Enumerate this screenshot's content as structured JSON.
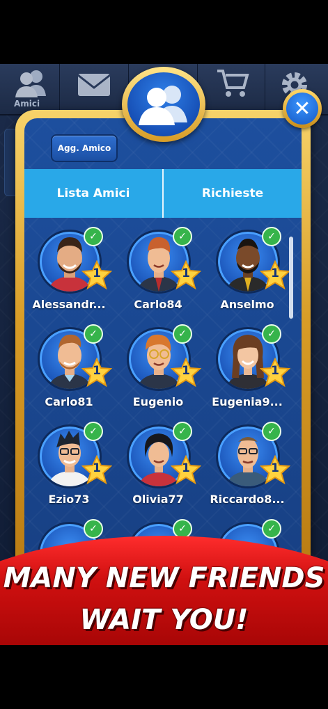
{
  "topbar": {
    "tab_label": "Amici"
  },
  "panel": {
    "add_friend_label": "Agg. Amico",
    "tabs": [
      {
        "label": "Lista Amici",
        "active": true
      },
      {
        "label": "Richieste",
        "active": false
      }
    ],
    "close_label": "✕"
  },
  "friends": [
    {
      "name": "Alessandr...",
      "level": "1",
      "online": true
    },
    {
      "name": "Carlo84",
      "level": "1",
      "online": true
    },
    {
      "name": "Anselmo",
      "level": "1",
      "online": true
    },
    {
      "name": "Carlo81",
      "level": "1",
      "online": true
    },
    {
      "name": "Eugenio",
      "level": "1",
      "online": true
    },
    {
      "name": "Eugenia9...",
      "level": "1",
      "online": true
    },
    {
      "name": "Ezio73",
      "level": "1",
      "online": true
    },
    {
      "name": "Olivia77",
      "level": "1",
      "online": true
    },
    {
      "name": "Riccardo8...",
      "level": "1",
      "online": true
    }
  ],
  "banner": {
    "line1": "MANY NEW FRIENDS",
    "line2": "WAIT YOU!"
  },
  "colors": {
    "panel_gold": "#d89c26",
    "panel_blue": "#1d4f9e",
    "tab_blue": "#29a8e8",
    "online_green": "#36b44b",
    "banner_red": "#d01010"
  }
}
